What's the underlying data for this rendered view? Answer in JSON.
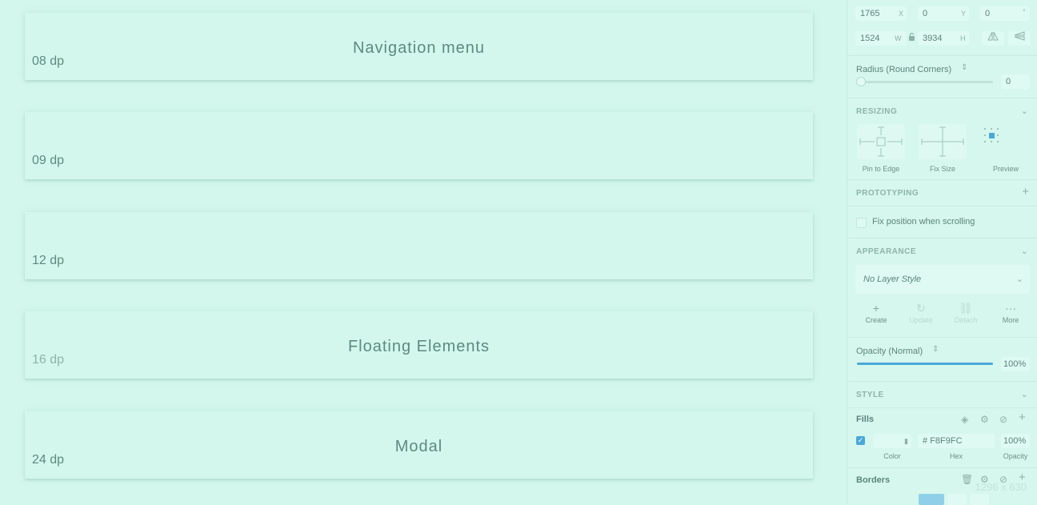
{
  "canvas": {
    "cards": [
      {
        "title": "Navigation menu",
        "dp": "08 dp"
      },
      {
        "title": "",
        "dp": "09 dp"
      },
      {
        "title": "",
        "dp": "12 dp"
      },
      {
        "title": "Floating Elements",
        "dp": "16 dp"
      },
      {
        "title": "Modal",
        "dp": "24 dp"
      }
    ]
  },
  "inspector": {
    "position": {
      "x": "1765",
      "x_label": "X",
      "y": "0",
      "y_label": "Y",
      "rotation": "0",
      "rotation_label": "°",
      "w": "1524",
      "w_label": "W",
      "h": "3934",
      "h_label": "H"
    },
    "radius": {
      "label": "Radius (Round Corners)",
      "value": "0"
    },
    "resizing": {
      "header": "RESIZING",
      "pin_label": "Pin to Edge",
      "fix_label": "Fix Size",
      "preview_label": "Preview"
    },
    "prototyping": {
      "header": "PROTOTYPING",
      "fix_position_label": "Fix position when scrolling"
    },
    "appearance": {
      "header": "APPEARANCE",
      "layer_style": "No Layer Style",
      "actions": [
        {
          "label": "Create",
          "icon": "plus-icon",
          "enabled": true
        },
        {
          "label": "Update",
          "icon": "refresh-icon",
          "enabled": false
        },
        {
          "label": "Detach",
          "icon": "detach-icon",
          "enabled": false
        },
        {
          "label": "More",
          "icon": "more-icon",
          "enabled": true
        }
      ],
      "opacity_label": "Opacity (Normal)",
      "opacity_value": "100%",
      "opacity_level": 1.0
    },
    "style": {
      "header": "STYLE",
      "fills_label": "Fills",
      "fill_hex": "F8F9FC",
      "fill_hex_prefix": "#",
      "fill_opacity": "100%",
      "fill_color_caption": "Color",
      "fill_hex_caption": "Hex",
      "fill_opacity_caption": "Opacity",
      "fill_enabled": true,
      "borders_label": "Borders"
    },
    "size_overlay": "1296 x 630"
  },
  "colors": {
    "background": "#d3f7ec",
    "accent": "#4aa8d8",
    "text": "#5f8a7f"
  }
}
